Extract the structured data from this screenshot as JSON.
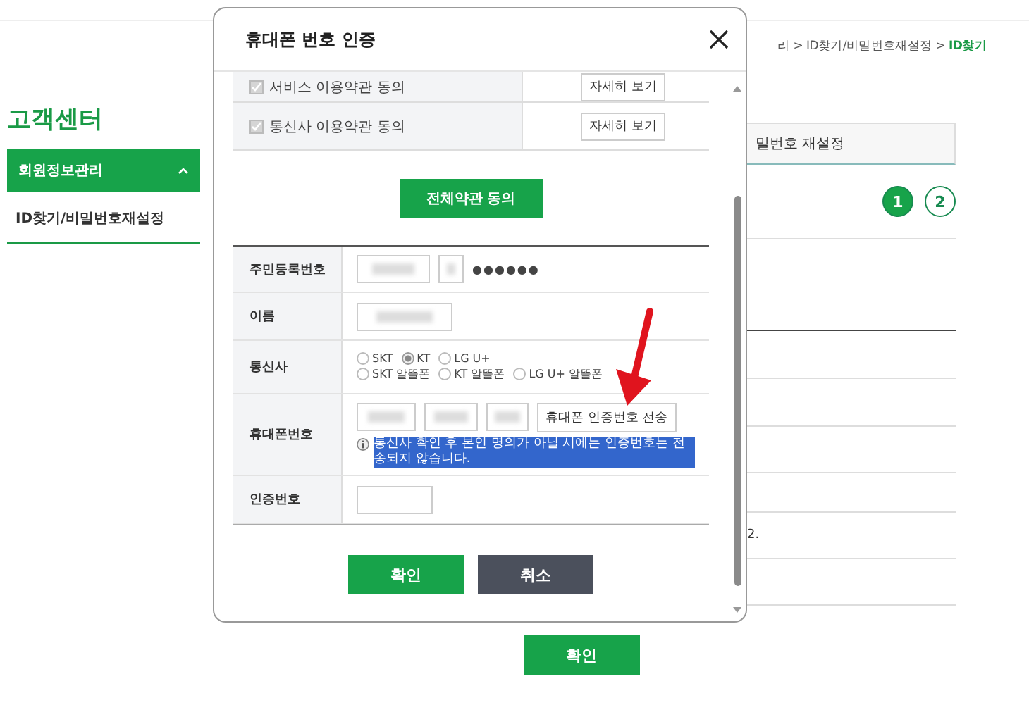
{
  "sidebar": {
    "title": "고객센터",
    "menu": {
      "label": "회원정보관리",
      "expanded": true
    },
    "items": [
      {
        "label": "ID찾기/비밀번호재설정",
        "selected": true
      }
    ]
  },
  "breadcrumb": {
    "prefix": "리 > ID찾기/비밀번호재설정 > ",
    "current": "ID찾기"
  },
  "tab": {
    "label": "밀번호 재설정"
  },
  "steps": [
    {
      "label": "1",
      "selected": true
    },
    {
      "label": "2",
      "selected": false
    }
  ],
  "page_note": "2.",
  "page_button": "확인",
  "dialog": {
    "title": "휴대폰 번호 인증",
    "agreements": [
      {
        "label": "서비스 이용약관 동의",
        "checked": true,
        "button": "자세히 보기"
      },
      {
        "label": "통신사 이용약관 동의",
        "checked": true,
        "button": "자세히 보기"
      }
    ],
    "agree_all_button": "전체약관 동의",
    "form": {
      "rows": [
        {
          "label": "주민등록번호",
          "kind": "resident",
          "masked": "●●●●●●"
        },
        {
          "label": "이름",
          "kind": "name"
        },
        {
          "label": "통신사",
          "kind": "carrier",
          "options": [
            {
              "label": "SKT",
              "selected": false
            },
            {
              "label": "KT",
              "selected": true
            },
            {
              "label": "LG U+",
              "selected": false
            },
            {
              "label": "SKT 알뜰폰",
              "selected": false
            },
            {
              "label": "KT 알뜰폰",
              "selected": false
            },
            {
              "label": "LG U+ 알뜰폰",
              "selected": false
            }
          ]
        },
        {
          "label": "휴대폰번호",
          "kind": "phone",
          "button": "휴대폰 인증번호 전송",
          "note": "통신사 확인 후 본인 명의가 아닐 시에는 인증번호는 전송되지 않습니다.",
          "note_highlighted": true
        },
        {
          "label": "인증번호",
          "kind": "code"
        }
      ]
    },
    "buttons": [
      {
        "label": "확인",
        "kind": "primary"
      },
      {
        "label": "취소",
        "kind": "secondary"
      }
    ]
  }
}
